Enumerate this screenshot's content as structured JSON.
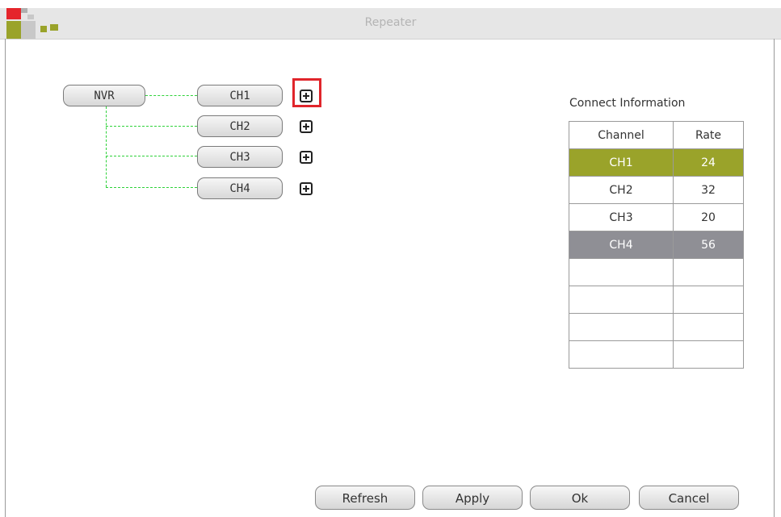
{
  "window": {
    "title": "Repeater"
  },
  "topology": {
    "root": "NVR",
    "channels": [
      "CH1",
      "CH2",
      "CH3",
      "CH4"
    ],
    "selected_add": "CH1"
  },
  "connect_info": {
    "title": "Connect Information",
    "headers": [
      "Channel",
      "Rate"
    ],
    "rows": [
      {
        "channel": "CH1",
        "rate": "24"
      },
      {
        "channel": "CH2",
        "rate": "32"
      },
      {
        "channel": "CH3",
        "rate": "20"
      },
      {
        "channel": "CH4",
        "rate": "56"
      }
    ],
    "row_colors": {
      "CH1": "#9aa32a",
      "CH4": "#8f8f95"
    }
  },
  "buttons": {
    "refresh": "Refresh",
    "apply": "Apply",
    "ok": "Ok",
    "cancel": "Cancel"
  },
  "icons": {
    "add": "plus-square-icon"
  }
}
